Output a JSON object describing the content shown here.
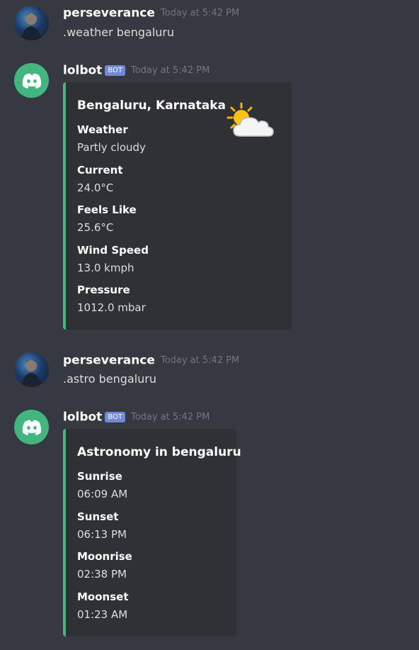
{
  "messages": [
    {
      "author": "perseverance",
      "timestamp": "Today at 5:42 PM",
      "content": ".weather bengaluru"
    },
    {
      "author": "lolbot",
      "badge": "BOT",
      "timestamp": "Today at 5:42 PM",
      "embed": {
        "title": "Bengaluru, Karnataka",
        "thumbnail_icon": "partly-cloudy-icon",
        "fields": [
          {
            "name": "Weather",
            "value": "Partly cloudy"
          },
          {
            "name": "Current",
            "value": "24.0°C"
          },
          {
            "name": "Feels Like",
            "value": "25.6°C"
          },
          {
            "name": "Wind Speed",
            "value": "13.0 kmph"
          },
          {
            "name": "Pressure",
            "value": "1012.0 mbar"
          }
        ]
      }
    },
    {
      "author": "perseverance",
      "timestamp": "Today at 5:42 PM",
      "content": ".astro bengaluru"
    },
    {
      "author": "lolbot",
      "badge": "BOT",
      "timestamp": "Today at 5:42 PM",
      "embed": {
        "title": "Astronomy in bengaluru",
        "fields": [
          {
            "name": "Sunrise",
            "value": "06:09 AM"
          },
          {
            "name": "Sunset",
            "value": "06:13 PM"
          },
          {
            "name": "Moonrise",
            "value": "02:38 PM"
          },
          {
            "name": "Moonset",
            "value": "01:23 AM"
          }
        ]
      }
    }
  ],
  "colors": {
    "background": "#36393f",
    "embed_background": "#2f3136",
    "embed_accent": "#43b581",
    "bot_badge": "#7289da",
    "bot_avatar": "#43b581",
    "timestamp": "#72767d"
  }
}
